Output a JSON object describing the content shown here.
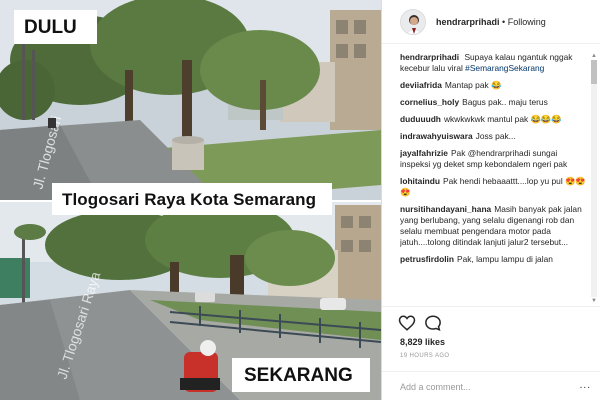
{
  "photo": {
    "label_top": "DULU",
    "label_middle": "Tlogosari Raya Kota Semarang",
    "label_bottom": "SEKARANG",
    "street_sign_top": "Jl. Tlogosari",
    "street_sign_bottom": "Jl. Tlogosari Raya"
  },
  "post": {
    "username": "hendrarprihadi",
    "separator": "•",
    "follow_label": "Following",
    "caption_user": "hendrarprihadi",
    "caption_text": "Supaya kalau ngantuk nggak kecebur lalu viral",
    "caption_tag": "#SemarangSekarang",
    "comments": [
      {
        "user": "deviiafrida",
        "text": "Mantap pak 😂"
      },
      {
        "user": "cornelius_holy",
        "text": "Bagus pak.. maju terus"
      },
      {
        "user": "duduuudh",
        "text": "wkwkwkwk mantul pak 😂😂😂"
      },
      {
        "user": "indrawahyuiswara",
        "text": "Joss pak..."
      },
      {
        "user": "jayalfahrizie",
        "text": "Pak @hendrarprihadi sungai inspeksi yg deket smp kebondalem ngeri pak"
      },
      {
        "user": "lohitaindu",
        "text": "Pak hendi hebaaattt....lop yu pul 😍😍😍"
      },
      {
        "user": "nursitihandayani_hana",
        "text": "Masih banyak pak jalan yang berlubang, yang selalu digenangi rob dan selalu membuat pengendara motor pada jatuh....tolong ditindak lanjuti jalur2 tersebut..."
      },
      {
        "user": "petrusfirdolin",
        "text": "Pak, lampu lampu di jalan"
      }
    ],
    "likes": "8,829 likes",
    "time": "19 HOURS AGO",
    "comment_placeholder": "Add a comment...",
    "more_label": "..."
  },
  "colors": {
    "label_bg": "#ffffff",
    "link": "#003569",
    "muted": "#999999",
    "border": "#dbdbdb"
  },
  "icons": [
    "heart-icon",
    "comment-icon",
    "scroll-up-icon",
    "scroll-down-icon"
  ]
}
